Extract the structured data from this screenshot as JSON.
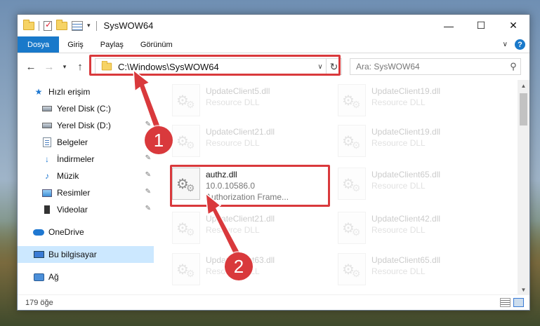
{
  "window": {
    "title": "SysWOW64"
  },
  "ribbon": {
    "tabs": [
      "Dosya",
      "Giriş",
      "Paylaş",
      "Görünüm"
    ]
  },
  "navbar": {
    "address": "C:\\Windows\\SysWOW64",
    "search_placeholder": "Ara: SysWOW64"
  },
  "sidebar": {
    "items": [
      {
        "label": "Hızlı erişim",
        "icon": "star-icon"
      },
      {
        "label": "Yerel Disk (C:)",
        "icon": "disk-icon"
      },
      {
        "label": "Yerel Disk (D:)",
        "icon": "disk-icon"
      },
      {
        "label": "Belgeler",
        "icon": "documents-icon"
      },
      {
        "label": "İndirmeler",
        "icon": "download-icon"
      },
      {
        "label": "Müzik",
        "icon": "music-icon"
      },
      {
        "label": "Resimler",
        "icon": "pictures-icon"
      },
      {
        "label": "Videolar",
        "icon": "videos-icon"
      },
      {
        "label": "OneDrive",
        "icon": "cloud-icon"
      },
      {
        "label": "Bu bilgisayar",
        "icon": "computer-icon"
      },
      {
        "label": "Ağ",
        "icon": "network-icon"
      }
    ]
  },
  "files": [
    {
      "name": "UpdateClient5.dll",
      "line2": "Resource DLL"
    },
    {
      "name": "UpdateClient19.dll",
      "line2": "Resource DLL"
    },
    {
      "name": "UpdateClient21.dll",
      "line2": "Resource DLL"
    },
    {
      "name": "UpdateClient19.dll",
      "line2": "Resource DLL"
    },
    {
      "name": "authz.dll",
      "line2": "10.0.10586.0",
      "line3": "Authorization Frame..."
    },
    {
      "name": "UpdateClient65.dll",
      "line2": "Resource DLL"
    },
    {
      "name": "UpdateClient21.dll",
      "line2": "Resource DLL"
    },
    {
      "name": "UpdateClient42.dll",
      "line2": "Resource DLL"
    },
    {
      "name": "UpdateClient63.dll",
      "line2": "Resource DLL"
    },
    {
      "name": "UpdateClient65.dll",
      "line2": "Resource DLL"
    }
  ],
  "status": {
    "count": "179 öğe"
  },
  "callouts": [
    "1",
    "2"
  ],
  "colors": {
    "accent": "#1979ca",
    "highlight": "#d9393c",
    "selected": "#cce8ff"
  }
}
